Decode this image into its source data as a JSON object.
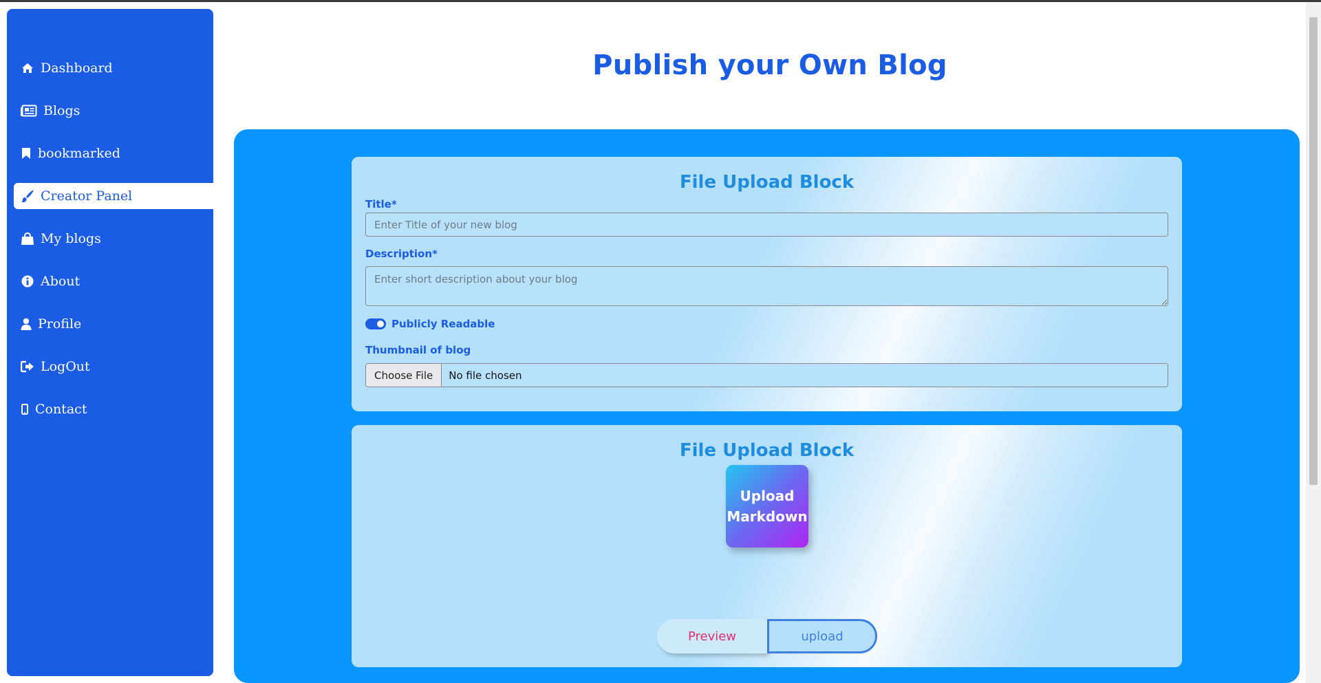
{
  "sidebar": {
    "items": [
      {
        "label": "Dashboard",
        "icon": "home-icon"
      },
      {
        "label": "Blogs",
        "icon": "newspaper-icon"
      },
      {
        "label": "bookmarked",
        "icon": "bookmark-icon"
      },
      {
        "label": "Creator Panel",
        "icon": "paintbrush-icon",
        "active": true
      },
      {
        "label": "My blogs",
        "icon": "shopping-bag-icon"
      },
      {
        "label": "About",
        "icon": "info-circle-icon"
      },
      {
        "label": "Profile",
        "icon": "user-icon"
      },
      {
        "label": "LogOut",
        "icon": "sign-out-icon"
      },
      {
        "label": "Contact",
        "icon": "mobile-phone-icon"
      }
    ]
  },
  "page": {
    "title": "Publish your Own Blog"
  },
  "card1": {
    "title": "File Upload Block",
    "title_label": "Title*",
    "title_placeholder": "Enter Title of your new blog",
    "description_label": "Description*",
    "description_placeholder": "Enter short description about your blog",
    "toggle_label": "Publicly Readable",
    "toggle_on": true,
    "thumbnail_label": "Thumbnail of blog",
    "choose_file_label": "Choose File",
    "file_status": "No file chosen"
  },
  "card2": {
    "title": "File Upload Block",
    "upload_tile_line1": "Upload",
    "upload_tile_line2": "Markdown",
    "preview_label": "Preview",
    "upload_label": "upload"
  },
  "colors": {
    "sidebar": "#1a5ce4",
    "panel": "#0996ff",
    "card_title": "#1f8ddd",
    "preview_text": "#e0306a"
  }
}
